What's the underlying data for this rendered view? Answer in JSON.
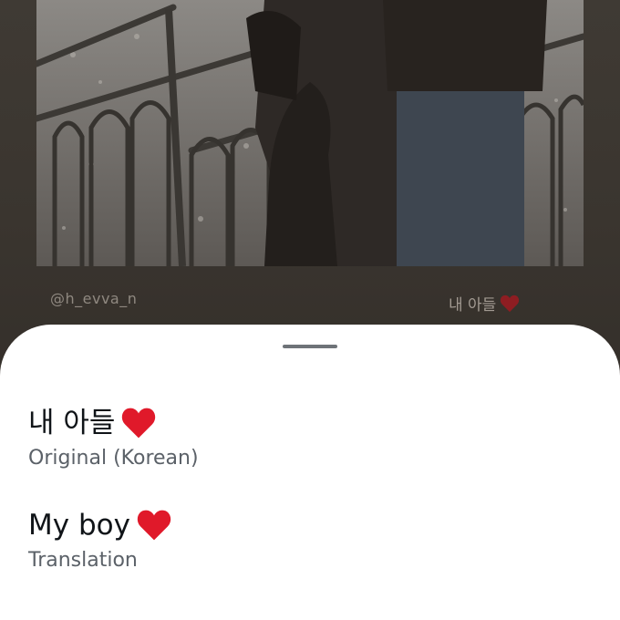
{
  "story": {
    "handle": "@h_evva_n",
    "caption_text": "내 아들",
    "caption_heart": "heart-icon"
  },
  "sheet": {
    "original": {
      "text": "내 아들",
      "label": "Original (Korean)"
    },
    "translation": {
      "text": "My boy",
      "label": "Translation"
    }
  },
  "colors": {
    "heart": "#e0192a",
    "sheet_background": "#ffffff",
    "primary_text": "#101418",
    "secondary_text": "#5b6168",
    "grabber": "#6e7378"
  }
}
